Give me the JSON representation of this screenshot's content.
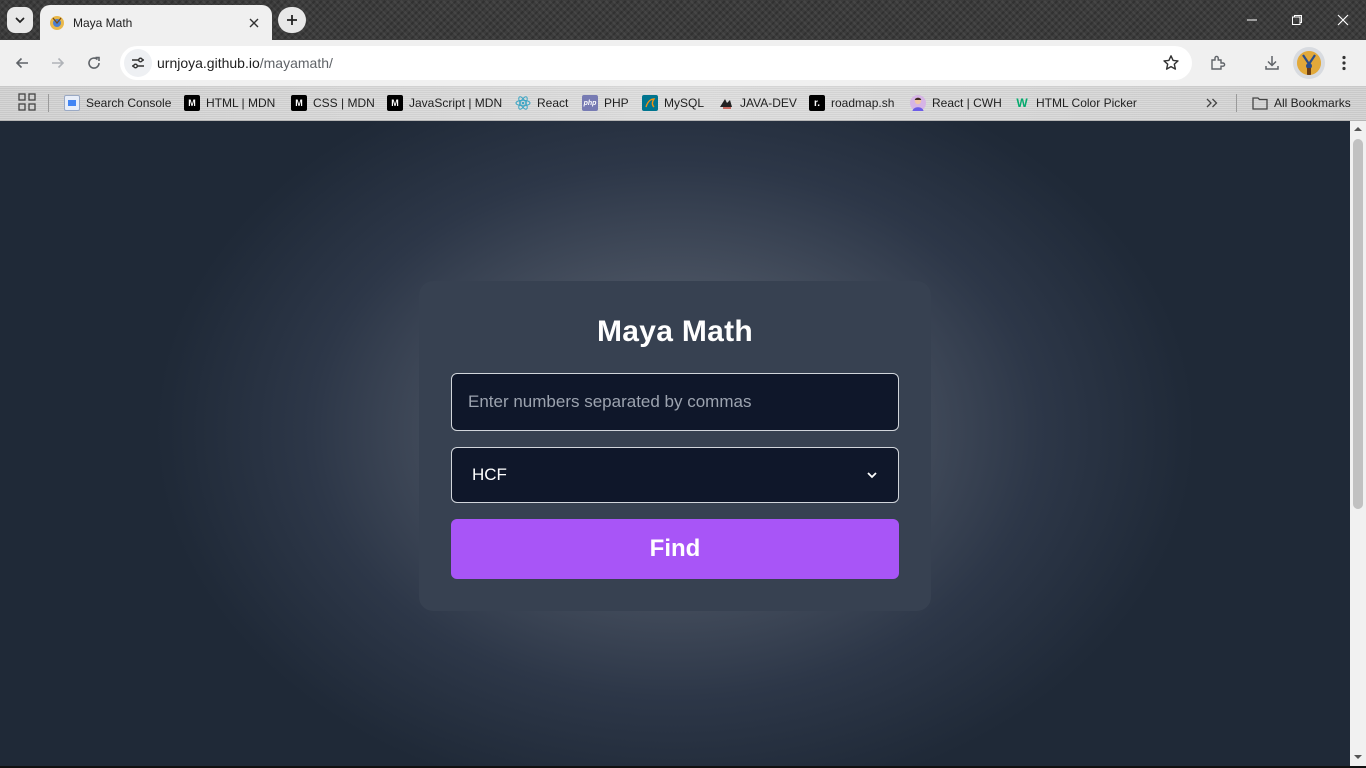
{
  "browser": {
    "tab": {
      "title": "Maya Math"
    },
    "address": {
      "host": "urnjoya.github.io",
      "path": "/mayamath/"
    },
    "bookmarks": [
      {
        "label": "Search Console",
        "icon": "search-console-icon",
        "color": "#4285f4"
      },
      {
        "label": "HTML | MDN",
        "icon": "mdn-icon",
        "color": "#000000"
      },
      {
        "label": "CSS | MDN",
        "icon": "mdn-icon",
        "color": "#000000"
      },
      {
        "label": "JavaScript | MDN",
        "icon": "mdn-icon",
        "color": "#000000"
      },
      {
        "label": "React",
        "icon": "react-icon",
        "color": "#58c4dc"
      },
      {
        "label": "PHP",
        "icon": "php-icon",
        "color": "#777bb3"
      },
      {
        "label": "MySQL",
        "icon": "mysql-icon",
        "color": "#00758f"
      },
      {
        "label": "JAVA-DEV",
        "icon": "java-dev-icon",
        "color": "#222222"
      },
      {
        "label": "roadmap.sh",
        "icon": "roadmap-icon",
        "color": "#000000"
      },
      {
        "label": "React | CWH",
        "icon": "cwh-avatar-icon",
        "color": "#c9a0dc"
      },
      {
        "label": "HTML Color Picker",
        "icon": "w3schools-icon",
        "color": "#04aa6d"
      }
    ],
    "all_bookmarks_label": "All Bookmarks"
  },
  "app": {
    "title": "Maya Math",
    "input": {
      "placeholder": "Enter numbers separated by commas",
      "value": ""
    },
    "operation": {
      "selected": "HCF"
    },
    "find_label": "Find"
  },
  "colors": {
    "card": "#374151",
    "field": "#0f172a",
    "accent": "#a855f7",
    "page_bg": "#1f2937"
  }
}
